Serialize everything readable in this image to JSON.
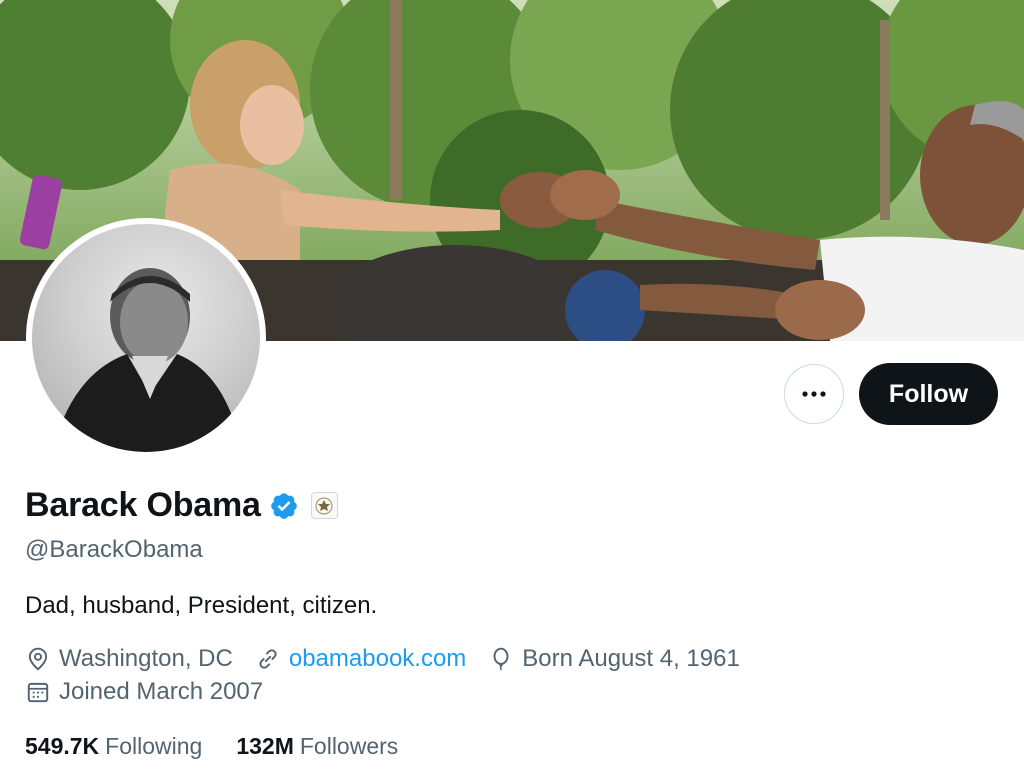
{
  "profile": {
    "display_name": "Barack Obama",
    "handle": "@BarackObama",
    "bio": "Dad, husband, President, citizen.",
    "location": "Washington, DC",
    "website": "obamabook.com",
    "birthday": "Born August 4, 1961",
    "joined": "Joined March 2007",
    "badges": [
      "verified-checkmark-icon",
      "us-government-seal-icon"
    ]
  },
  "actions": {
    "more_label": "···",
    "follow_label": "Follow"
  },
  "stats": {
    "following_count": "549.7K",
    "following_label": "Following",
    "followers_count": "132M",
    "followers_label": "Followers"
  },
  "colors": {
    "accent": "#1d9bf0",
    "text_primary": "#0f1419",
    "text_secondary": "#536471",
    "follow_button_bg": "#0f1419"
  }
}
